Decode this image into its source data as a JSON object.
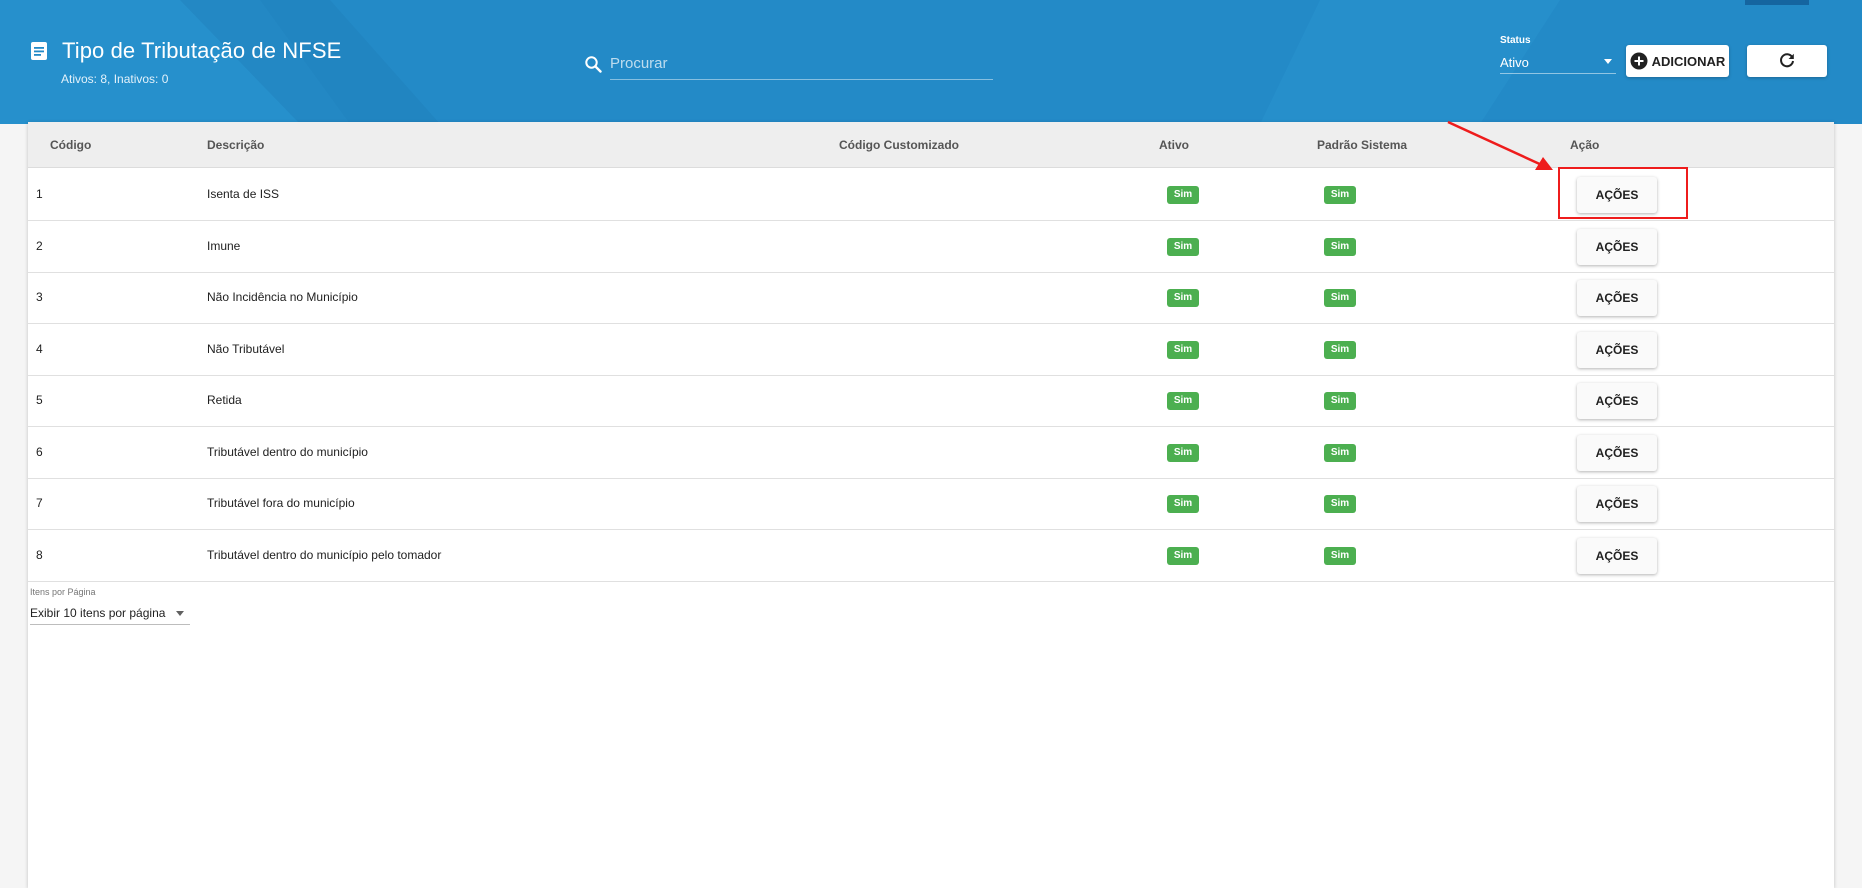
{
  "header": {
    "title": "Tipo de Tributação de NFSE",
    "subtitle": "Ativos: 8, Inativos: 0",
    "search_placeholder": "Procurar",
    "status_label": "Status",
    "status_value": "Ativo",
    "add_button_label": "ADICIONAR"
  },
  "table": {
    "columns": [
      "Código",
      "Descrição",
      "Código Customizado",
      "Ativo",
      "Padrão Sistema",
      "Ação"
    ],
    "rows": [
      {
        "codigo": "1",
        "descricao": "Isenta de ISS",
        "codigo_customizado": "",
        "ativo": "Sim",
        "padrao": "Sim",
        "acao": "AÇÕES"
      },
      {
        "codigo": "2",
        "descricao": "Imune",
        "codigo_customizado": "",
        "ativo": "Sim",
        "padrao": "Sim",
        "acao": "AÇÕES"
      },
      {
        "codigo": "3",
        "descricao": "Não Incidência no Município",
        "codigo_customizado": "",
        "ativo": "Sim",
        "padrao": "Sim",
        "acao": "AÇÕES"
      },
      {
        "codigo": "4",
        "descricao": "Não Tributável",
        "codigo_customizado": "",
        "ativo": "Sim",
        "padrao": "Sim",
        "acao": "AÇÕES"
      },
      {
        "codigo": "5",
        "descricao": "Retida",
        "codigo_customizado": "",
        "ativo": "Sim",
        "padrao": "Sim",
        "acao": "AÇÕES"
      },
      {
        "codigo": "6",
        "descricao": "Tributável dentro do município",
        "codigo_customizado": "",
        "ativo": "Sim",
        "padrao": "Sim",
        "acao": "AÇÕES"
      },
      {
        "codigo": "7",
        "descricao": "Tributável fora do município",
        "codigo_customizado": "",
        "ativo": "Sim",
        "padrao": "Sim",
        "acao": "AÇÕES"
      },
      {
        "codigo": "8",
        "descricao": "Tributável dentro do município pelo tomador",
        "codigo_customizado": "",
        "ativo": "Sim",
        "padrao": "Sim",
        "acao": "AÇÕES"
      }
    ]
  },
  "pagination": {
    "label": "Itens por Página",
    "value": "Exibir 10 itens por página"
  },
  "icons": {
    "title": "document-icon",
    "search": "search-icon",
    "add": "plus-circle-icon",
    "refresh": "refresh-icon"
  },
  "colors": {
    "header_bg": "#238ac7",
    "badge_green": "#4caf50",
    "annotation_red": "#ee1c1c"
  }
}
